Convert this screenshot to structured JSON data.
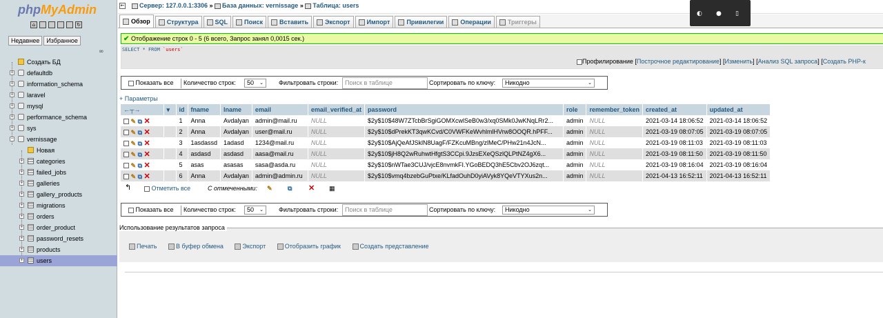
{
  "sidebar": {
    "logo": {
      "part1": "php",
      "part2": "MyAdmin"
    },
    "recent_tab": "Недавнее",
    "favorites_tab": "Избранное",
    "tree": [
      {
        "label": "Создать БД",
        "kind": "new-db"
      },
      {
        "label": "defaultdb",
        "kind": "db"
      },
      {
        "label": "information_schema",
        "kind": "db"
      },
      {
        "label": "laravel",
        "kind": "db"
      },
      {
        "label": "mysql",
        "kind": "db"
      },
      {
        "label": "performance_schema",
        "kind": "db"
      },
      {
        "label": "sys",
        "kind": "db"
      },
      {
        "label": "vernissage",
        "kind": "db",
        "expanded": true
      },
      {
        "label": "Новая",
        "kind": "new-tbl"
      },
      {
        "label": "categories",
        "kind": "tbl"
      },
      {
        "label": "failed_jobs",
        "kind": "tbl"
      },
      {
        "label": "galleries",
        "kind": "tbl"
      },
      {
        "label": "gallery_products",
        "kind": "tbl"
      },
      {
        "label": "migrations",
        "kind": "tbl"
      },
      {
        "label": "orders",
        "kind": "tbl"
      },
      {
        "label": "order_product",
        "kind": "tbl"
      },
      {
        "label": "password_resets",
        "kind": "tbl"
      },
      {
        "label": "products",
        "kind": "tbl"
      },
      {
        "label": "users",
        "kind": "tbl",
        "active": true
      }
    ]
  },
  "breadcrumb": {
    "server": "Сервер: 127.0.0.1:3306",
    "database": "База данных: vernissage",
    "table": "Таблица: users",
    "separator": "»"
  },
  "tabs": [
    {
      "label": "Обзор",
      "active": true
    },
    {
      "label": "Структура"
    },
    {
      "label": "SQL"
    },
    {
      "label": "Поиск"
    },
    {
      "label": "Вставить"
    },
    {
      "label": "Экспорт"
    },
    {
      "label": "Импорт"
    },
    {
      "label": "Привилегии"
    },
    {
      "label": "Операции"
    },
    {
      "label": "Триггеры",
      "disabled": true
    }
  ],
  "success_message": "Отображение строк 0 - 5 (6 всего, Запрос занял 0,0015 сек.)",
  "sql": {
    "keyword1": "SELECT",
    "star": " * ",
    "keyword2": "FROM",
    "table": " `users`"
  },
  "sql_links": {
    "profiling": "Профилирование",
    "inline_edit": "Построчное редактирование",
    "edit": "Изменить",
    "explain": "Анализ SQL запроса",
    "create_php": "Создать PHP-к"
  },
  "navbar": {
    "show_all": "Показать все",
    "row_count_label": "Количество строк:",
    "row_count_value": "50",
    "filter_label": "Фильтровать строки:",
    "filter_placeholder": "Поиск в таблице",
    "sort_label": "Сортировать по ключу:",
    "sort_value": "Никодно"
  },
  "params_link": "+ Параметры",
  "table": {
    "columns": [
      "id",
      "fname",
      "lname",
      "email",
      "email_verified_at",
      "password",
      "role",
      "remember_token",
      "created_at",
      "updated_at"
    ],
    "rows": [
      [
        "1",
        "Anna",
        "Avdalyan",
        "admin@mail.ru",
        "NULL",
        "$2y$10$48W7ZTcbBrSgiGOMXcwlSeB0w3/xq0SMk0JwKNqLRr2...",
        "admin",
        "NULL",
        "2021-03-14 18:06:52",
        "2021-03-14 18:06:52"
      ],
      [
        "2",
        "Anna",
        "Avdalyan",
        "user@mail.ru",
        "NULL",
        "$2y$10$dPrekKT3qwKCvd/C0VWFKeWvhlmlHVrw8OOQR.hPFF...",
        "admin",
        "NULL",
        "2021-03-19 08:07:05",
        "2021-03-19 08:07:05"
      ],
      [
        "3",
        "1asdassd",
        "1adasd",
        "1234@mail.ru",
        "NULL",
        "$2y$10$AjQeAfJSklN8UagF/FZKcuMBng/zlMeC/PHw21n4JcN...",
        "admin",
        "NULL",
        "2021-03-19 08:11:03",
        "2021-03-19 08:11:03"
      ],
      [
        "4",
        "asdasd",
        "asdasd",
        "aasa@mail.ru",
        "NULL",
        "$2y$10$jH8Q2wRuhwtHfgtS3CCpi.9JzsEXeQSzlQLPtNZ4gX6...",
        "admin",
        "NULL",
        "2021-03-19 08:11:50",
        "2021-03-19 08:11:50"
      ],
      [
        "5",
        "asas",
        "asasas",
        "sasa@asda.ru",
        "NULL",
        "$2y$10$nWTae3CUJ/vjcE8nvmkFI.YGoBEDQ3hE5Cbv2OJ6zqt...",
        "admin",
        "NULL",
        "2021-03-19 08:16:04",
        "2021-03-19 08:16:04"
      ],
      [
        "6",
        "Anna",
        "Avdalyan",
        "admin@admin.ru",
        "NULL",
        "$2y$10$vmq4bzebGuPtxe/KLfadOuhD0yiAVyk8YQeVTYXus2n...",
        "admin",
        "NULL",
        "2021-04-13 16:52:11",
        "2021-04-13 16:52:11"
      ]
    ]
  },
  "bulk": {
    "check_all": "Отметить все",
    "with_selected": "С отмеченными:"
  },
  "operations": {
    "legend": "Использование результатов запроса",
    "print": "Печать",
    "clipboard": "В буфер обмена",
    "export": "Экспорт",
    "chart": "Отобразить график",
    "view": "Создать представление"
  },
  "colors": {
    "link": "#235a81",
    "success_border": "#00c900",
    "success_bg": "#ebf8a4",
    "active_nav": "#9aa4d6",
    "header_bg": "#c8d6df"
  },
  "icons": {
    "popup": [
      "edge-icon",
      "drop-icon",
      "trash-icon"
    ]
  }
}
